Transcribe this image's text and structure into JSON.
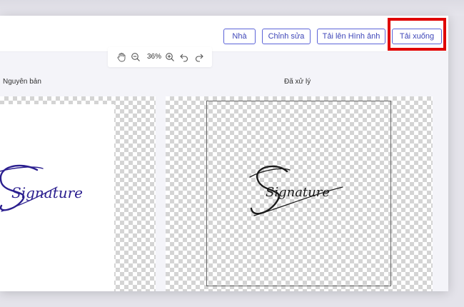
{
  "header": {
    "buttons": {
      "home": "Nhà",
      "edit": "Chỉnh sửa",
      "upload": "Tải lên Hình ảnh",
      "download": "Tải xuống"
    }
  },
  "zoom": {
    "value": "36%"
  },
  "panels": {
    "original_label": "Nguyên bản",
    "processed_label": "Đã xử lý"
  },
  "signature_text": "Signature",
  "colors": {
    "accent": "#5b63d8",
    "highlight": "#e00000",
    "signature_original": "#2b1f8f",
    "signature_processed": "#1a1a1a"
  }
}
